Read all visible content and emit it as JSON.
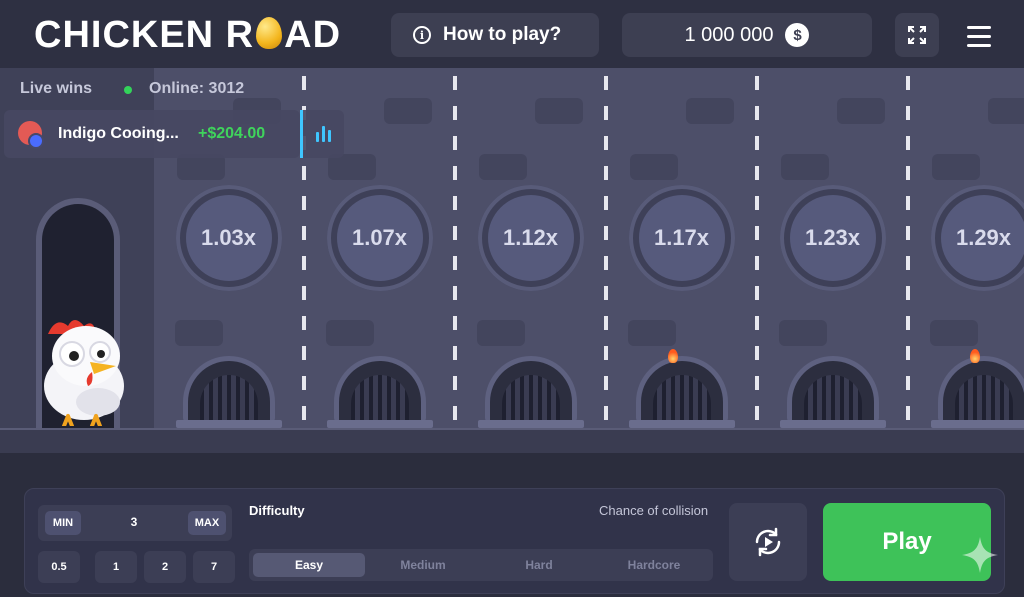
{
  "header": {
    "logo_left": "CHICKEN R",
    "logo_right": "AD",
    "how_to_play": "How to play?",
    "balance": "1 000 000",
    "currency_symbol": "$"
  },
  "live": {
    "title": "Live wins",
    "online": "Online: 3012",
    "latest_win": {
      "name": "Indigo Cooing...",
      "amount": "+$204.00"
    }
  },
  "lanes": [
    {
      "multiplier": "1.03x",
      "flame": false
    },
    {
      "multiplier": "1.07x",
      "flame": false
    },
    {
      "multiplier": "1.12x",
      "flame": false
    },
    {
      "multiplier": "1.17x",
      "flame": true
    },
    {
      "multiplier": "1.23x",
      "flame": false
    },
    {
      "multiplier": "1.29x",
      "flame": true
    }
  ],
  "bet": {
    "min_label": "MIN",
    "value": "3",
    "max_label": "MAX",
    "quick": [
      "0.5",
      "1",
      "2",
      "7"
    ]
  },
  "difficulty": {
    "label": "Difficulty",
    "collision_label": "Chance of collision",
    "options": [
      "Easy",
      "Medium",
      "Hard",
      "Hardcore"
    ],
    "selected": "Easy"
  },
  "play_label": "Play",
  "colors": {
    "accent_green": "#3ec259",
    "win_green": "#3fd45c",
    "background": "#2b2d3d"
  }
}
